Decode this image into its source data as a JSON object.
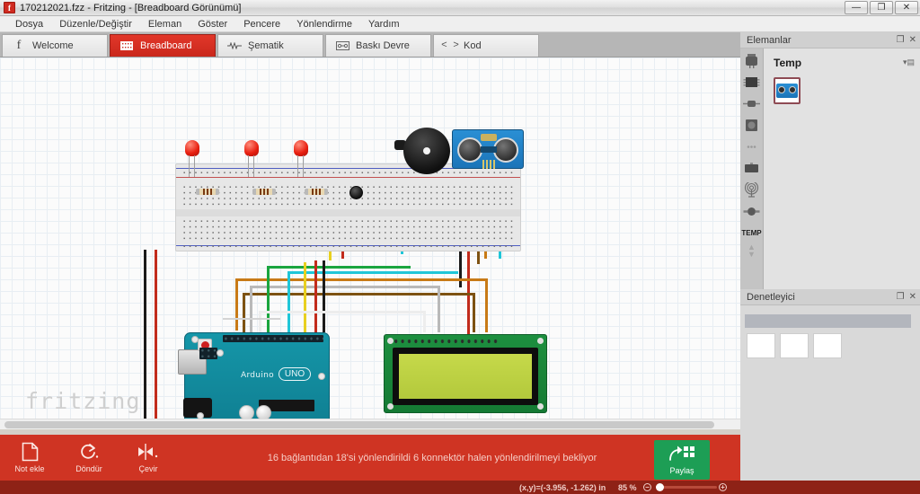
{
  "window": {
    "title": "170212021.fzz - Fritzing - [Breadboard Görünümü]",
    "app_icon": "fritzing-icon",
    "minimize": "—",
    "maximize": "❐",
    "close": "✕"
  },
  "menu": {
    "items": [
      {
        "label": "Dosya"
      },
      {
        "label": "Düzenle/Değiştir"
      },
      {
        "label": "Eleman"
      },
      {
        "label": "Göster"
      },
      {
        "label": "Pencere"
      },
      {
        "label": "Yönlendirme"
      },
      {
        "label": "Yardım"
      }
    ]
  },
  "tabs": [
    {
      "label": "Welcome",
      "icon": "fritzing-f-icon",
      "active": false
    },
    {
      "label": "Breadboard",
      "icon": "breadboard-icon",
      "active": true
    },
    {
      "label": "Şematik",
      "icon": "schematic-icon",
      "active": false
    },
    {
      "label": "Baskı Devre",
      "icon": "pcb-icon",
      "active": false
    },
    {
      "label": "Kod",
      "icon": "code-icon",
      "active": false
    }
  ],
  "canvas": {
    "watermark": "fritzing",
    "components": {
      "leds": [
        "led-1",
        "led-2",
        "led-3"
      ],
      "resistors": [
        "resistor-1",
        "resistor-2",
        "resistor-3"
      ],
      "buzzer": "buzzer",
      "ultrasonic": "HC-SR04",
      "trimpot": "trimpot",
      "microcontroller": "Arduino UNO",
      "arduino_logo": "Arduino",
      "arduino_model": "UNO",
      "display": "LCD 16x2",
      "breadboard": "full-size-breadboard"
    }
  },
  "parts_panel": {
    "title": "Elemanlar",
    "float_icon": "undock-icon",
    "close_icon": "close-icon",
    "section_title": "Temp",
    "menu_icon": "bin-menu-icon",
    "bin_label": "TEMP",
    "bin_icons": [
      "core-parts-icon",
      "ic-icon",
      "resistor-icon",
      "button-icon",
      "more-icon",
      "module-icon",
      "rf-icon",
      "connector-icon"
    ],
    "part_tile": "hc-sr04-part"
  },
  "inspector_panel": {
    "title": "Denetleyici",
    "float_icon": "undock-icon",
    "close_icon": "close-icon",
    "swatches": [
      "swatch-1",
      "swatch-2",
      "swatch-3"
    ]
  },
  "bottom_toolbar": {
    "tools": [
      {
        "label": "Not ekle",
        "icon": "note-icon"
      },
      {
        "label": "Döndür",
        "icon": "rotate-icon"
      },
      {
        "label": "Çevir",
        "icon": "flip-icon"
      }
    ],
    "status_message": "16 bağlantıdan 18'si yönlendirildi 6 konnektör halen yönlendirilmeyi bekliyor",
    "share": {
      "label": "Paylaş",
      "icon": "share-icon"
    }
  },
  "status_bar": {
    "coordinates": "(x,y)=(-3.956, -1.262) in",
    "zoom": "85 %",
    "zoom_out_icon": "minus-icon",
    "zoom_in_icon": "plus-icon"
  },
  "colors": {
    "accent_red": "#cf3423",
    "accent_dark_red": "#8e2216",
    "share_green": "#1d9e55",
    "arduino_teal": "#1596a8",
    "lcd_green": "#c6d94a",
    "sensor_blue": "#2a8fd4"
  }
}
